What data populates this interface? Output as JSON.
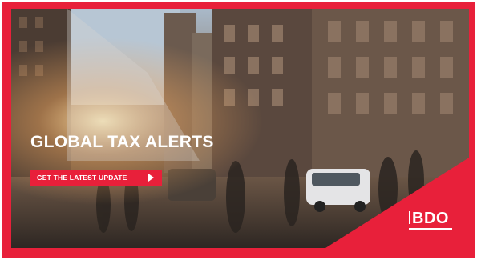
{
  "banner": {
    "headline": "GLOBAL TAX ALERTS",
    "cta_label": "GET THE LATEST UPDATE",
    "cta_icon": "play-arrow-icon",
    "brand": "BDO",
    "brand_color": "#e8203a",
    "text_color": "#ffffff"
  }
}
